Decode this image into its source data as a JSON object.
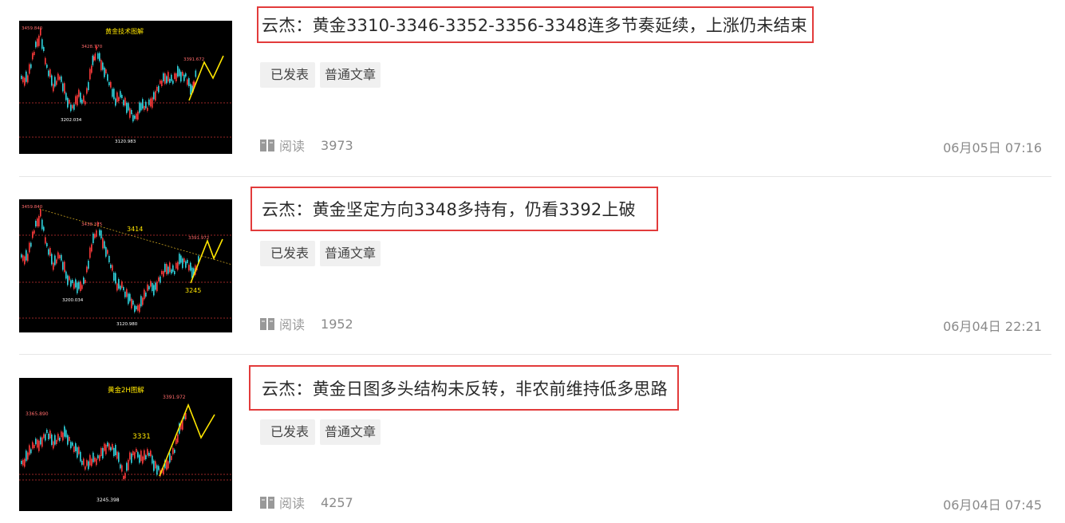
{
  "articles": [
    {
      "title": "云杰：黄金3310-3346-3352-3356-3348连多节奏延续，上涨仍未结束",
      "tags": [
        "已发表",
        "普通文章"
      ],
      "read_label": "阅读",
      "read_count": "3973",
      "date": "06月05日 07:16",
      "thumb": {
        "caption": "黄金技术图解",
        "labels": [
          "3459.840",
          "3428.770",
          "3391.672",
          "3202.034",
          "3120.983"
        ]
      }
    },
    {
      "title": "云杰：黄金坚定方向3348多持有，仍看3392上破",
      "tags": [
        "已发表",
        "普通文章"
      ],
      "read_label": "阅读",
      "read_count": "1952",
      "date": "06月04日 22:21",
      "thumb": {
        "caption": "",
        "labels": [
          "3459.840",
          "3438.375",
          "3414",
          "3391.972",
          "3200.034",
          "3245",
          "3120.980"
        ]
      }
    },
    {
      "title": "云杰：黄金日图多头结构未反转，非农前维持低多思路",
      "tags": [
        "已发表",
        "普通文章"
      ],
      "read_label": "阅读",
      "read_count": "4257",
      "date": "06月04日 07:45",
      "thumb": {
        "caption": "黄金2H图解",
        "labels": [
          "3391.972",
          "3365.890",
          "3331",
          "3245.398"
        ]
      }
    }
  ],
  "colors": {
    "highlight_border": "#e23b3b",
    "candle_up": "#ff3b3b",
    "candle_down": "#30d6e0",
    "projection": "#ffe600"
  }
}
